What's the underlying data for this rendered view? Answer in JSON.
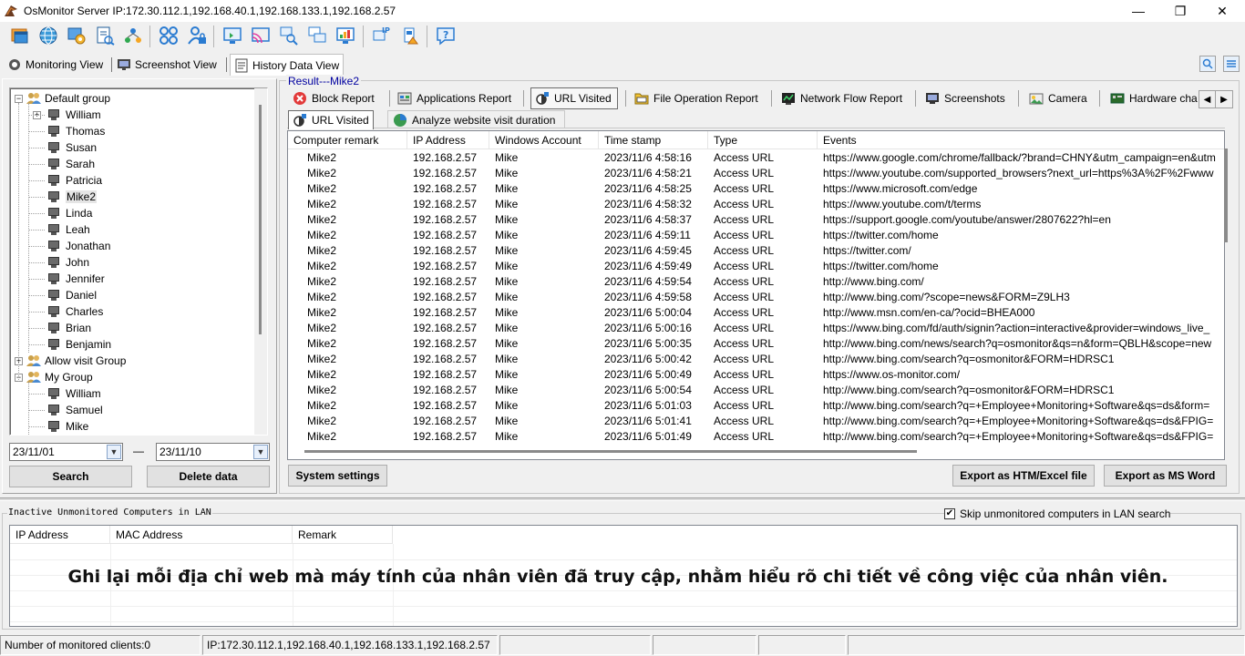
{
  "window": {
    "title": "OsMonitor Server   IP:172.30.112.1,192.168.40.1,192.168.133.1,192.168.2.57",
    "minimize": "—",
    "maximize": "❐",
    "close": "✕"
  },
  "toolbar": {
    "icons": [
      "window-icon",
      "globe-icon",
      "settings-user-icon",
      "report-icon",
      "network-users-icon",
      "apps-grid-icon",
      "lock-person-icon",
      "remote-screen-icon",
      "cast-icon",
      "search-pc-icon",
      "multi-screen-icon",
      "monitor-chart-icon",
      "ip-icon",
      "usb-icon",
      "help-icon"
    ]
  },
  "view_tabs": [
    {
      "label": "Monitoring View",
      "icon": "monitor-view-icon"
    },
    {
      "label": "Screenshot View",
      "icon": "screenshot-view-icon"
    },
    {
      "label": "History Data View",
      "icon": "history-view-icon"
    }
  ],
  "tree": {
    "groups": [
      {
        "name": "Default group",
        "members": [
          "William",
          "Thomas",
          "Susan",
          "Sarah",
          "Patricia",
          "Mike2",
          "Linda",
          "Leah",
          "Jonathan",
          "John",
          "Jennifer",
          "Daniel",
          "Charles",
          "Brian",
          "Benjamin"
        ]
      },
      {
        "name": "Allow visit Group",
        "members": []
      },
      {
        "name": "My Group",
        "members": [
          "William",
          "Samuel",
          "Mike"
        ]
      }
    ]
  },
  "date_range": {
    "start": "23/11/01",
    "end": "23/11/10",
    "separator": "—"
  },
  "left_buttons": {
    "search": "Search",
    "delete": "Delete data"
  },
  "result": {
    "label": "Result---Mike2",
    "report_tabs": [
      {
        "label": "Block Report",
        "icon": "block-icon"
      },
      {
        "label": "Applications Report",
        "icon": "app-report-icon"
      },
      {
        "label": "URL Visited",
        "icon": "url-icon"
      },
      {
        "label": "File Operation Report",
        "icon": "file-op-icon"
      },
      {
        "label": "Network Flow Report",
        "icon": "network-flow-icon"
      },
      {
        "label": "Screenshots",
        "icon": "screenshot-icon"
      },
      {
        "label": "Camera",
        "icon": "camera-icon"
      },
      {
        "label": "Hardware cha",
        "icon": "hardware-icon"
      }
    ],
    "sub_tabs": [
      {
        "label": "URL Visited",
        "icon": "url-icon"
      },
      {
        "label": "Analyze website visit duration",
        "icon": "analyze-icon"
      }
    ],
    "columns": [
      "Computer remark",
      "IP Address",
      "Windows Account",
      "Time stamp",
      "Type",
      "Events"
    ],
    "rows": [
      [
        "Mike2",
        "192.168.2.57",
        "Mike",
        "2023/11/6 4:58:16",
        "Access URL",
        "https://www.google.com/chrome/fallback/?brand=CHNY&utm_campaign=en&utm"
      ],
      [
        "Mike2",
        "192.168.2.57",
        "Mike",
        "2023/11/6 4:58:21",
        "Access URL",
        "https://www.youtube.com/supported_browsers?next_url=https%3A%2F%2Fwww"
      ],
      [
        "Mike2",
        "192.168.2.57",
        "Mike",
        "2023/11/6 4:58:25",
        "Access URL",
        "https://www.microsoft.com/edge"
      ],
      [
        "Mike2",
        "192.168.2.57",
        "Mike",
        "2023/11/6 4:58:32",
        "Access URL",
        "https://www.youtube.com/t/terms"
      ],
      [
        "Mike2",
        "192.168.2.57",
        "Mike",
        "2023/11/6 4:58:37",
        "Access URL",
        "https://support.google.com/youtube/answer/2807622?hl=en"
      ],
      [
        "Mike2",
        "192.168.2.57",
        "Mike",
        "2023/11/6 4:59:11",
        "Access URL",
        "https://twitter.com/home"
      ],
      [
        "Mike2",
        "192.168.2.57",
        "Mike",
        "2023/11/6 4:59:45",
        "Access URL",
        "https://twitter.com/"
      ],
      [
        "Mike2",
        "192.168.2.57",
        "Mike",
        "2023/11/6 4:59:49",
        "Access URL",
        "https://twitter.com/home"
      ],
      [
        "Mike2",
        "192.168.2.57",
        "Mike",
        "2023/11/6 4:59:54",
        "Access URL",
        "http://www.bing.com/"
      ],
      [
        "Mike2",
        "192.168.2.57",
        "Mike",
        "2023/11/6 4:59:58",
        "Access URL",
        "http://www.bing.com/?scope=news&FORM=Z9LH3"
      ],
      [
        "Mike2",
        "192.168.2.57",
        "Mike",
        "2023/11/6 5:00:04",
        "Access URL",
        "http://www.msn.com/en-ca/?ocid=BHEA000"
      ],
      [
        "Mike2",
        "192.168.2.57",
        "Mike",
        "2023/11/6 5:00:16",
        "Access URL",
        "https://www.bing.com/fd/auth/signin?action=interactive&provider=windows_live_"
      ],
      [
        "Mike2",
        "192.168.2.57",
        "Mike",
        "2023/11/6 5:00:35",
        "Access URL",
        "http://www.bing.com/news/search?q=osmonitor&qs=n&form=QBLH&scope=new"
      ],
      [
        "Mike2",
        "192.168.2.57",
        "Mike",
        "2023/11/6 5:00:42",
        "Access URL",
        "http://www.bing.com/search?q=osmonitor&FORM=HDRSC1"
      ],
      [
        "Mike2",
        "192.168.2.57",
        "Mike",
        "2023/11/6 5:00:49",
        "Access URL",
        "https://www.os-monitor.com/"
      ],
      [
        "Mike2",
        "192.168.2.57",
        "Mike",
        "2023/11/6 5:00:54",
        "Access URL",
        "http://www.bing.com/search?q=osmonitor&FORM=HDRSC1"
      ],
      [
        "Mike2",
        "192.168.2.57",
        "Mike",
        "2023/11/6 5:01:03",
        "Access URL",
        "http://www.bing.com/search?q=+Employee+Monitoring+Software&qs=ds&form="
      ],
      [
        "Mike2",
        "192.168.2.57",
        "Mike",
        "2023/11/6 5:01:41",
        "Access URL",
        "http://www.bing.com/search?q=+Employee+Monitoring+Software&qs=ds&FPIG="
      ],
      [
        "Mike2",
        "192.168.2.57",
        "Mike",
        "2023/11/6 5:01:49",
        "Access URL",
        "http://www.bing.com/search?q=+Employee+Monitoring+Software&qs=ds&FPIG="
      ]
    ]
  },
  "result_buttons": {
    "system_settings": "System settings",
    "export_html": "Export as HTM/Excel file",
    "export_word": "Export as MS Word"
  },
  "lan": {
    "label": "Inactive Unmonitored Computers in LAN",
    "skip_label": "Skip unmonitored computers in LAN search",
    "skip_checked": true,
    "columns": [
      "IP Address",
      "MAC Address",
      "Remark"
    ]
  },
  "caption": "Ghi lại mỗi địa chỉ web mà máy tính của nhân viên đã truy cập, nhằm hiểu rõ chi tiết về công việc của nhân viên.",
  "status_bar": {
    "clients": "Number of monitored clients:0",
    "ips": "IP:172.30.112.1,192.168.40.1,192.168.133.1,192.168.2.57"
  },
  "colors": {
    "block_red": "#e23a3a",
    "selected_tree_bg": "#e5e5e5",
    "result_label": "#0000a0"
  }
}
